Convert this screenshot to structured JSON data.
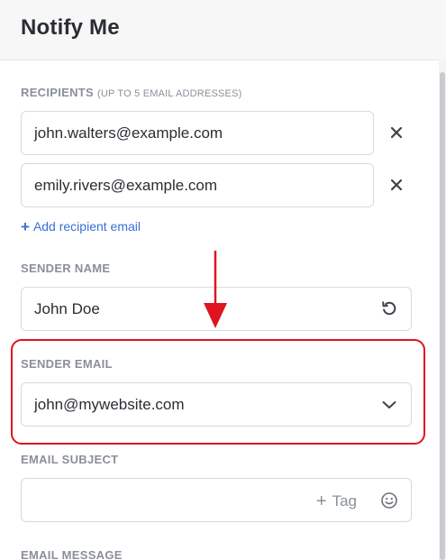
{
  "header": {
    "title": "Notify Me"
  },
  "recipients": {
    "label": "RECIPIENTS",
    "hint": "(UP TO 5 EMAIL ADDRESSES)",
    "items": [
      {
        "email": "john.walters@example.com"
      },
      {
        "email": "emily.rivers@example.com"
      }
    ],
    "add_label": "Add recipient email"
  },
  "sender_name": {
    "label": "SENDER NAME",
    "value": "John Doe"
  },
  "sender_email": {
    "label": "SENDER EMAIL",
    "value": "john@mywebsite.com"
  },
  "email_subject": {
    "label": "EMAIL SUBJECT",
    "value": "",
    "tag_label": "Tag"
  },
  "email_message": {
    "label": "EMAIL MESSAGE"
  },
  "icons": {
    "remove": "close-icon",
    "reset": "undo-icon",
    "dropdown": "chevron-down-icon",
    "emoji": "smiley-icon",
    "tag_plus": "plus-icon"
  },
  "colors": {
    "accent": "#3a6fd8",
    "highlight": "#e0141e",
    "label_gray": "#8a8f98"
  }
}
